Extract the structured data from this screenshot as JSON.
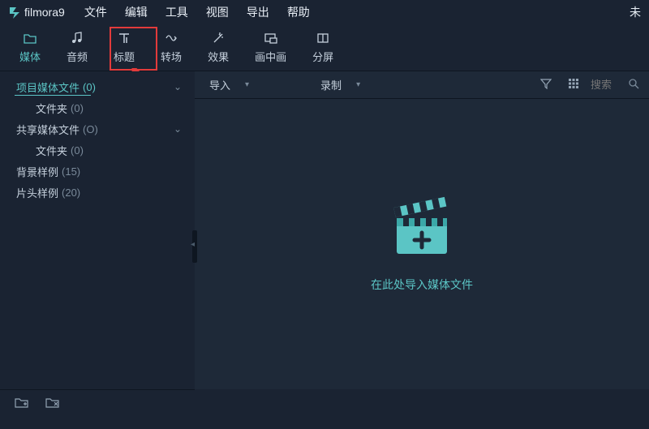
{
  "app": {
    "name": "filmora",
    "version": "9"
  },
  "menu": [
    "文件",
    "编辑",
    "工具",
    "视图",
    "导出",
    "帮助"
  ],
  "titlebar_right": "未",
  "tabs": [
    {
      "id": "media",
      "label": "媒体"
    },
    {
      "id": "audio",
      "label": "音频"
    },
    {
      "id": "title",
      "label": "标题"
    },
    {
      "id": "transition",
      "label": "转场"
    },
    {
      "id": "effect",
      "label": "效果"
    },
    {
      "id": "pip",
      "label": "画中画"
    },
    {
      "id": "split",
      "label": "分屏"
    }
  ],
  "active_tab": "media",
  "sidebar": {
    "items": [
      {
        "label": "项目媒体文件",
        "count": "(0)",
        "active": true,
        "expandable": true
      },
      {
        "label": "文件夹",
        "count": "(0)",
        "child": true
      },
      {
        "label": "共享媒体文件",
        "count": "(O)",
        "expandable": true
      },
      {
        "label": "文件夹",
        "count": "(0)",
        "child": true
      },
      {
        "label": "背景样例",
        "count": "(15)"
      },
      {
        "label": "片头样例",
        "count": "(20)"
      }
    ]
  },
  "content_toolbar": {
    "import_label": "导入",
    "record_label": "录制",
    "search_placeholder": "搜索"
  },
  "content_body": {
    "hint": "在此处导入媒体文件"
  },
  "colors": {
    "accent": "#5bc5c5",
    "highlight": "#e23b3b"
  }
}
